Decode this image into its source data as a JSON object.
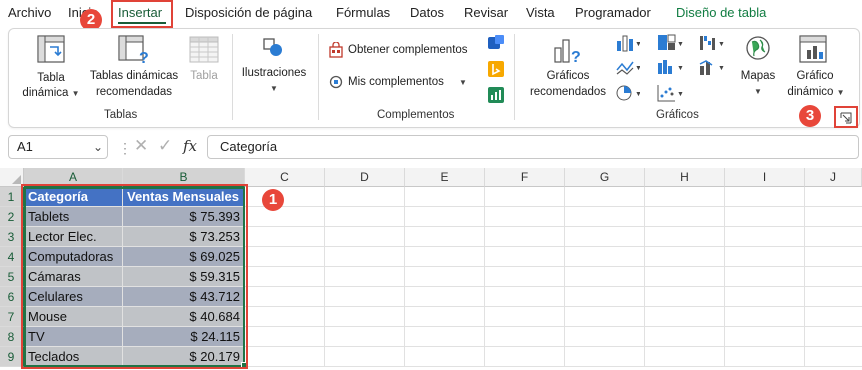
{
  "ribbon_tabs": [
    "Archivo",
    "Inicio",
    "Insertar",
    "Disposición de página",
    "Fórmulas",
    "Datos",
    "Revisar",
    "Vista",
    "Programador",
    "Diseño de tabla"
  ],
  "active_tab": "Insertar",
  "groups": {
    "tablas": {
      "label": "Tablas",
      "pivot_line1": "Tabla",
      "pivot_line2": "dinámica",
      "recommended_line1": "Tablas dinámicas",
      "recommended_line2": "recomendadas",
      "table": "Tabla"
    },
    "ilustraciones": {
      "label": "Ilustraciones"
    },
    "complementos": {
      "label": "Complementos",
      "get": "Obtener complementos",
      "mine": "Mis complementos"
    },
    "graficos": {
      "label": "Gráficos",
      "recommended_line1": "Gráficos",
      "recommended_line2": "recomendados",
      "maps": "Mapas",
      "pivot_chart_line1": "Gráfico",
      "pivot_chart_line2": "dinámico"
    }
  },
  "badges": [
    "1",
    "2",
    "3"
  ],
  "formula_bar": {
    "name_box": "A1",
    "fx": "fx",
    "content": "Categoría"
  },
  "columns": [
    "A",
    "B",
    "C",
    "D",
    "E",
    "F",
    "G",
    "H",
    "I",
    "J"
  ],
  "rows": [
    "1",
    "2",
    "3",
    "4",
    "5",
    "6",
    "7",
    "8",
    "9"
  ],
  "table": {
    "headers": [
      "Categoría",
      "Ventas Mensuales"
    ],
    "rows": [
      [
        "Tablets",
        "$ 75.393"
      ],
      [
        "Lector Elec.",
        "$ 73.253"
      ],
      [
        "Computadoras",
        "$ 69.025"
      ],
      [
        "Cámaras",
        "$ 59.315"
      ],
      [
        "Celulares",
        "$ 43.712"
      ],
      [
        "Mouse",
        "$ 40.684"
      ],
      [
        "TV",
        "$ 24.115"
      ],
      [
        "Teclados",
        "$ 20.179"
      ]
    ]
  },
  "colors": {
    "accent_green": "#185c37",
    "header_blue": "#4472c4",
    "band_dark": "#a6adbd",
    "band_light": "#c0c3c7",
    "badge_red": "#e8473a"
  }
}
